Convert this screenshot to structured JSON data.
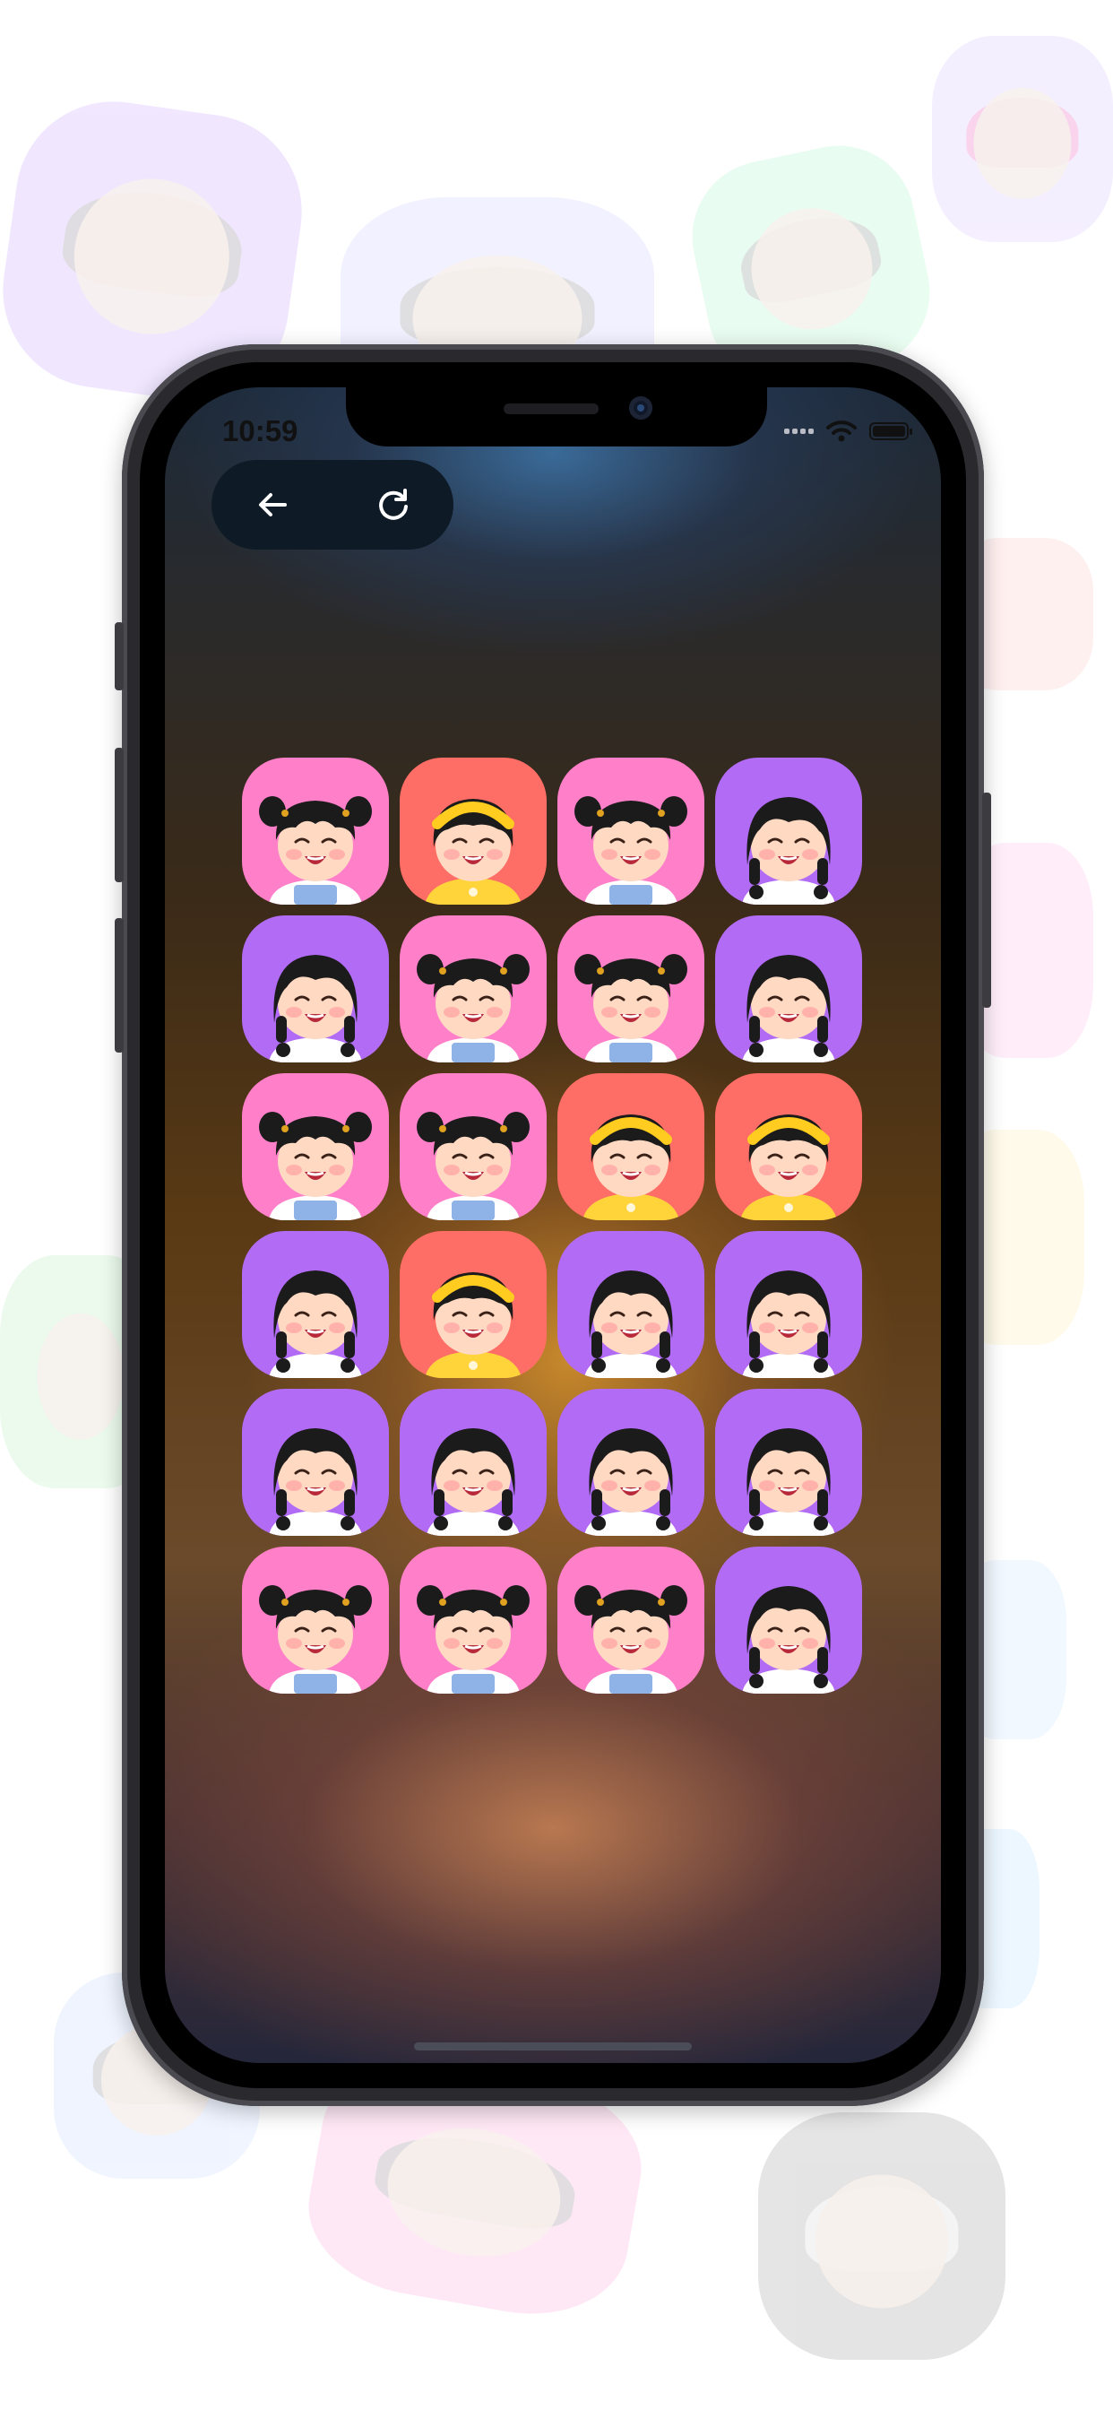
{
  "status_bar": {
    "time": "10:59"
  },
  "controls": {
    "back_icon": "arrow-left-icon",
    "restart_icon": "refresh-icon"
  },
  "palette": {
    "pink": "#ff80c8",
    "purple": "#b26bf5",
    "coral": "#ff6e66"
  },
  "grid": {
    "columns": 4,
    "rows": [
      [
        "pigtails-pink",
        "headband-coral",
        "pigtails-pink",
        "braids-purple"
      ],
      [
        "braids-purple",
        "pigtails-pink",
        "pigtails-pink",
        "braids-purple"
      ],
      [
        "pigtails-pink",
        "pigtails-pink",
        "headband-coral",
        "headband-coral"
      ],
      [
        "braids-purple",
        "headband-coral",
        "braids-purple",
        "braids-purple"
      ],
      [
        "braids-purple",
        "braids-purple",
        "braids-purple",
        "braids-purple"
      ],
      [
        "pigtails-pink",
        "pigtails-pink",
        "pigtails-pink",
        "braids-purple"
      ]
    ]
  }
}
